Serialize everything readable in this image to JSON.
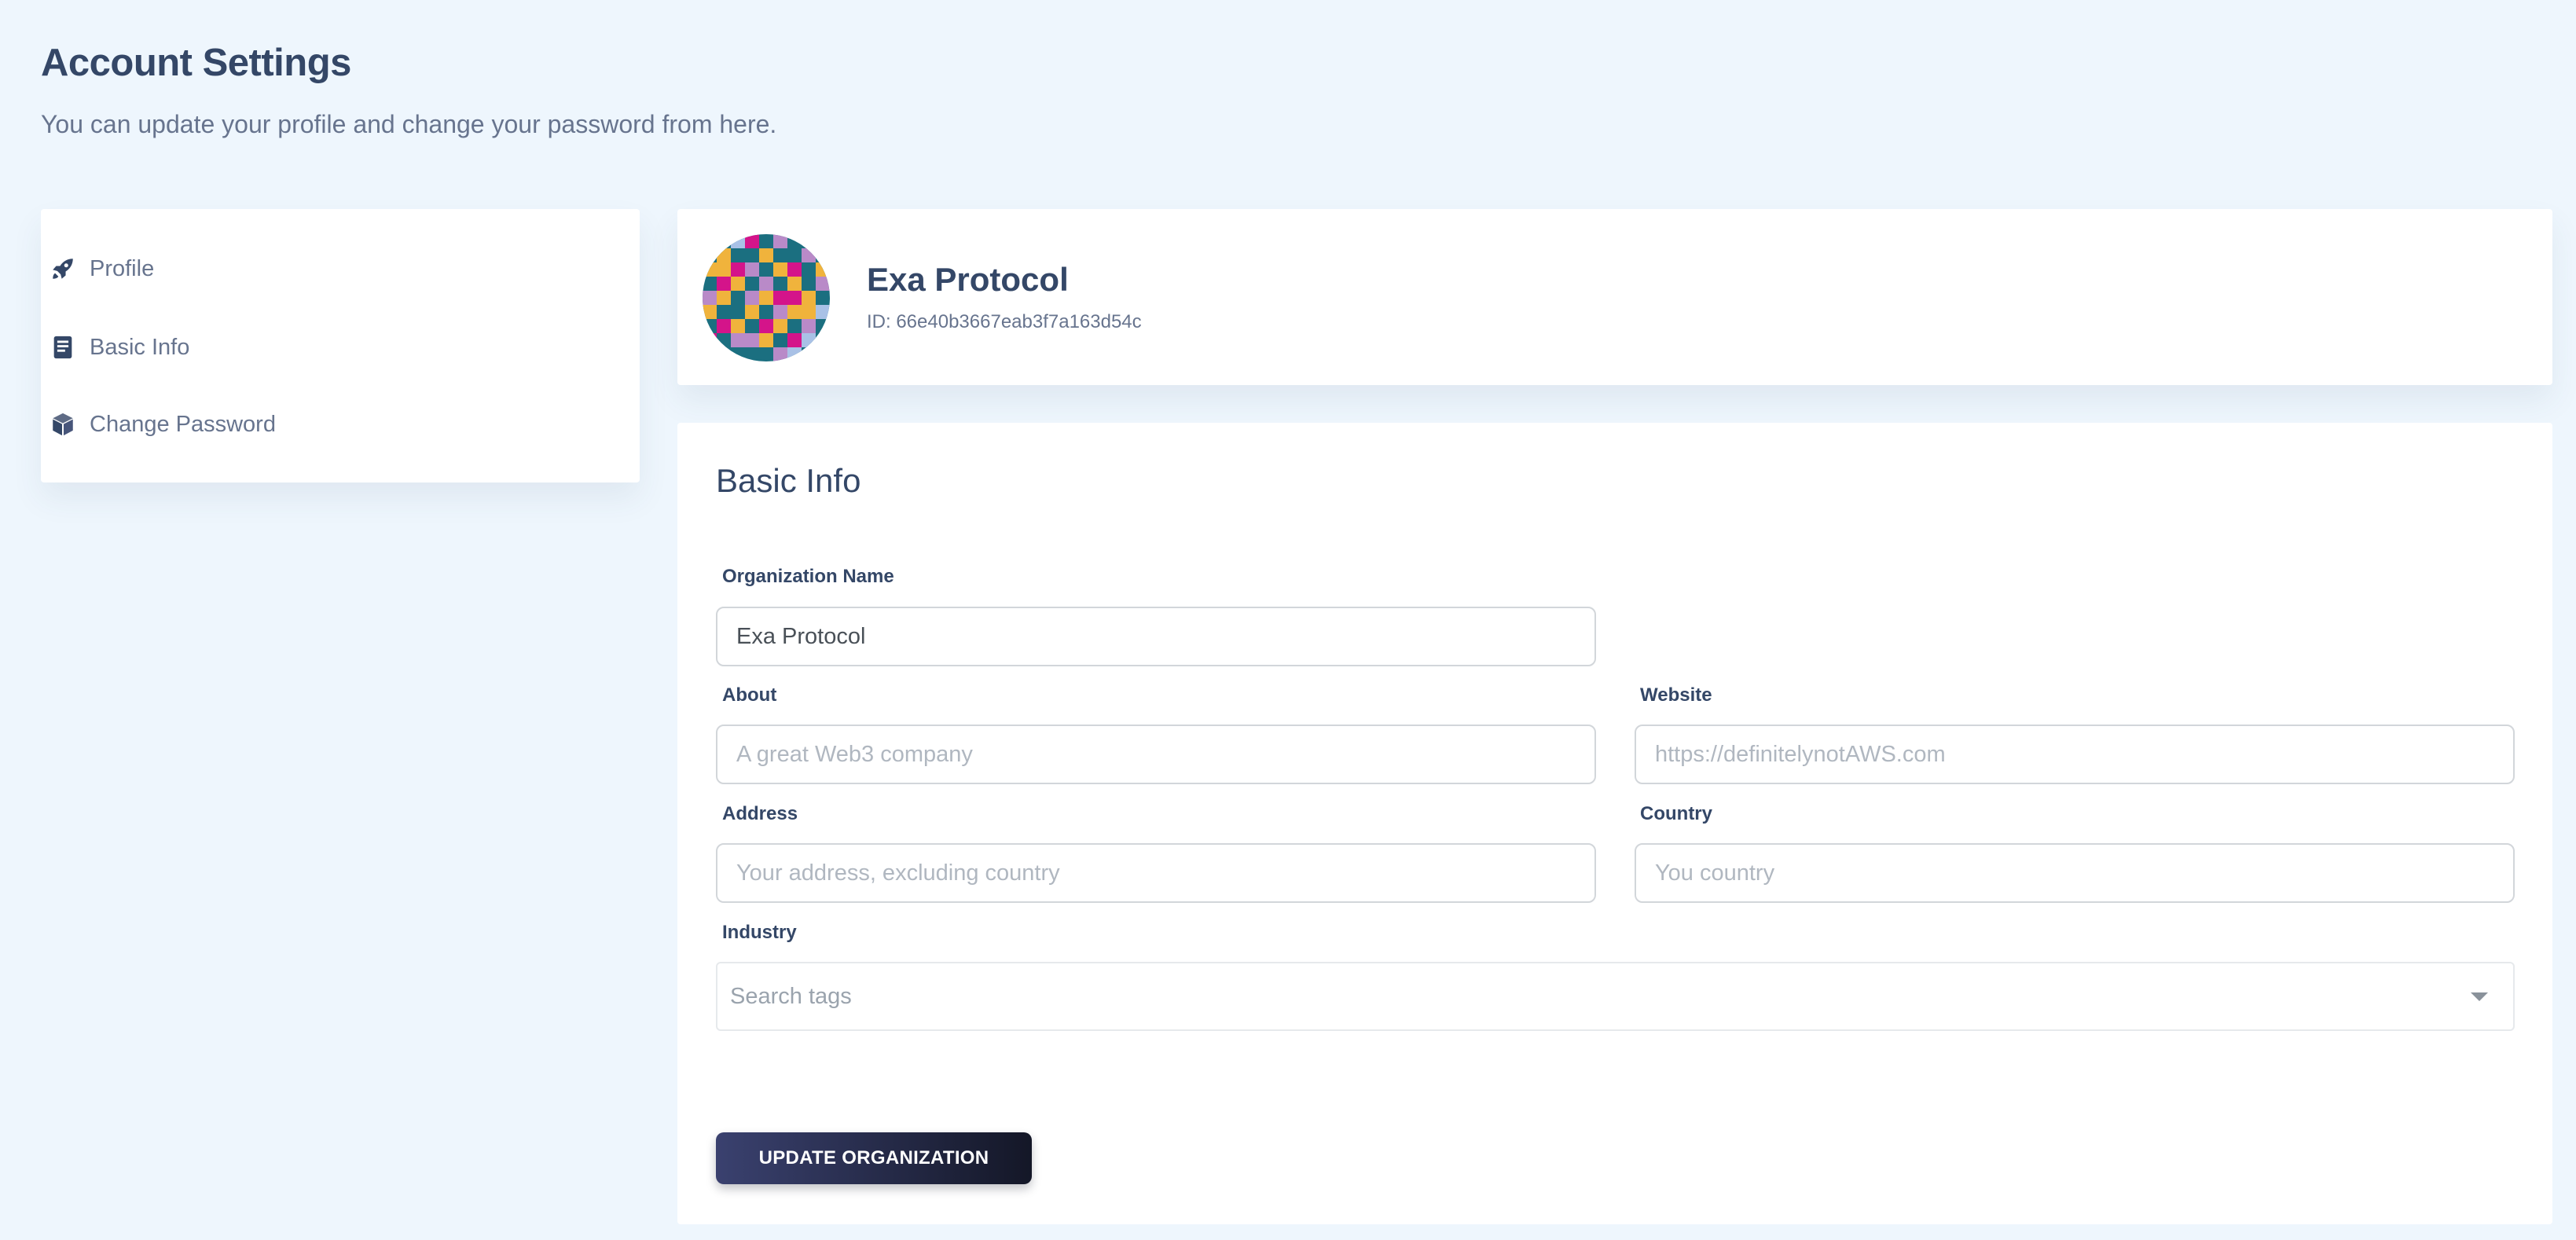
{
  "header": {
    "title": "Account Settings",
    "subtitle": "You can update your profile and change your password from here."
  },
  "sidebar": {
    "items": [
      {
        "label": "Profile",
        "icon": "rocket-icon"
      },
      {
        "label": "Basic Info",
        "icon": "document-icon"
      },
      {
        "label": "Change Password",
        "icon": "box-icon"
      }
    ]
  },
  "profile": {
    "name": "Exa Protocol",
    "id_text": "ID: 66e40b3667eab3f7a163d54c"
  },
  "basic_info": {
    "title": "Basic Info",
    "fields": {
      "org_name": {
        "label": "Organization Name",
        "value": "Exa Protocol"
      },
      "about": {
        "label": "About",
        "placeholder": "A great Web3 company"
      },
      "website": {
        "label": "Website",
        "placeholder": "https://definitelynotAWS.com"
      },
      "address": {
        "label": "Address",
        "placeholder": "Your address, excluding country"
      },
      "country": {
        "label": "Country",
        "placeholder": "You country"
      },
      "industry": {
        "label": "Industry",
        "placeholder": "Search tags"
      }
    },
    "submit_label": "UPDATE ORGANIZATION"
  },
  "colors": {
    "background": "#eef6fd",
    "text_primary": "#344767",
    "text_secondary": "#67748e",
    "button_gradient_start": "#3a416f",
    "button_gradient_end": "#141727"
  }
}
